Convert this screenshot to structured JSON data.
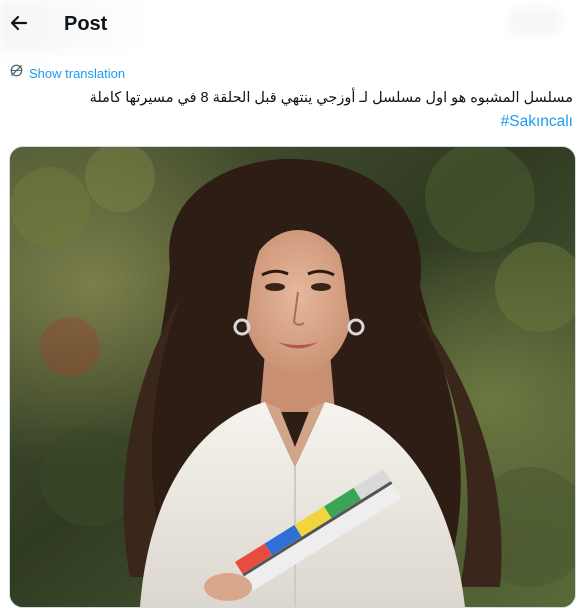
{
  "header": {
    "title": "Post"
  },
  "translation": {
    "label": "Show translation"
  },
  "tweet": {
    "text": "مسلسل المشبوه هو اول مسلسل لـ أوزجي ينتهي قبل الحلقة 8 في مسيرتها كاملة",
    "hashtag": "#Sakıncalı"
  },
  "icons": {
    "back": "arrow-left-icon",
    "translate": "globe-slash-icon"
  },
  "colors": {
    "accent": "#1d9bf0",
    "text": "#0f1419",
    "border": "#cfd9de"
  }
}
